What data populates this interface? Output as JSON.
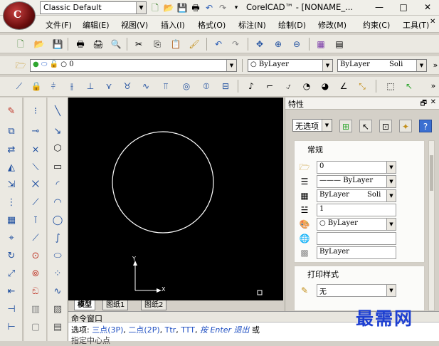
{
  "titlebar": {
    "workspace": "Classic Default",
    "app_title": "CorelCAD™ - [NONAME_...",
    "min": "—",
    "restore": "□",
    "close": "✕"
  },
  "menubar": {
    "items": [
      "文件(F)",
      "编辑(E)",
      "视图(V)",
      "插入(I)",
      "格式(O)",
      "标注(N)",
      "绘制(D)",
      "修改(M)",
      "约束(C)",
      "工具(T)"
    ],
    "close": "✕"
  },
  "layer_toolbar": {
    "layer_value": "0",
    "color_value": "ByLayer",
    "linetype_value": "ByLayer",
    "lineweight_value": "Soli",
    "more": "»"
  },
  "canvas": {
    "ucs_y": "Y",
    "ucs_x": "X"
  },
  "layout_tabs": [
    "模型",
    "图纸1",
    "图纸2"
  ],
  "properties": {
    "title": "特性",
    "pin": "🗗",
    "close": "✕",
    "selection": "无选项",
    "general_title": "常规",
    "layer": "0",
    "linetype": "ByLayer",
    "linetype_scale_name": "ByLayer",
    "linetype_scale_val": "Soli",
    "lineweight": "1",
    "color": "ByLayer",
    "transparency": "",
    "material": "ByLayer",
    "print_title": "打印样式",
    "print_style": "无"
  },
  "command": {
    "title": "命令窗口",
    "prefix": "选项: ",
    "opt1": "三点(3P)",
    "comma1": ", ",
    "opt2": "二点(2P)",
    "comma2": ", ",
    "opt3": "Ttr",
    "comma3": ", ",
    "opt4": "TTT",
    "comma4": ", ",
    "opt5": "按 Enter 退出",
    "suffix": " 或",
    "line2": "指定中心点"
  },
  "watermark": "最需网"
}
